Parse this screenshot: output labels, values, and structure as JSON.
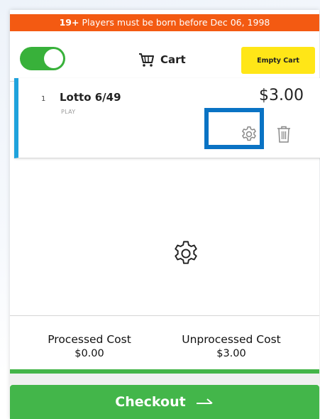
{
  "banner": {
    "age": "19+",
    "message": "Players must be born before Dec 06, 1998"
  },
  "header": {
    "toggle_state": "on",
    "cart_label": "Cart",
    "empty_cart_label": "Empty Cart"
  },
  "cart_items": [
    {
      "index": "1",
      "name": "Lotto 6/49",
      "subtitle": "PLAY",
      "price": "$3.00"
    }
  ],
  "costs": {
    "processed_label": "Processed Cost",
    "processed_value": "$0.00",
    "unprocessed_label": "Unprocessed Cost",
    "unprocessed_value": "$3.00"
  },
  "checkout": {
    "label": "Checkout"
  },
  "colors": {
    "banner": "#f35a12",
    "toggle": "#38b13a",
    "empty_cart_button": "#ffe617",
    "item_accent": "#1fa2dc",
    "highlight": "#0a73c4",
    "checkout": "#43b64a"
  },
  "icons": {
    "cart": "cart-icon",
    "settings": "gear-icon",
    "delete": "trash-icon",
    "checkout_arrow": "arrow-right-icon"
  }
}
